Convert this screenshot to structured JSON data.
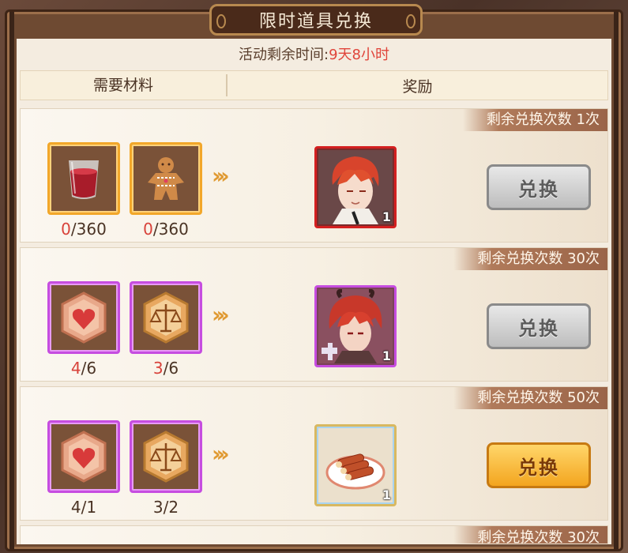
{
  "window": {
    "title": "限时道具兑换"
  },
  "timer": {
    "label": "活动剩余时间:",
    "value": "9天8小时"
  },
  "headers": {
    "materials": "需要材料",
    "reward": "奖励"
  },
  "rows": [
    {
      "remaining": "剩余兑换次数 1次",
      "materials": [
        {
          "icon": "juice-glass-icon",
          "have": "0",
          "need": "/360",
          "frame": "orange"
        },
        {
          "icon": "gingerbread-cookie-icon",
          "have": "0",
          "need": "/360",
          "frame": "orange"
        }
      ],
      "reward": {
        "icon": "red-hair-character-portrait",
        "qty": "1",
        "frame": "red"
      },
      "button": {
        "label": "兑换",
        "state": "disabled"
      }
    },
    {
      "remaining": "剩余兑换次数 30次",
      "materials": [
        {
          "icon": "heart-emblem-icon",
          "have": "4",
          "need": "/6",
          "frame": "purple"
        },
        {
          "icon": "scales-emblem-icon",
          "have": "3",
          "need": "/6",
          "frame": "purple"
        }
      ],
      "reward": {
        "icon": "character-fragment-portrait",
        "qty": "1",
        "frame": "purple"
      },
      "button": {
        "label": "兑换",
        "state": "disabled"
      }
    },
    {
      "remaining": "剩余兑换次数 50次",
      "materials": [
        {
          "icon": "heart-emblem-icon",
          "have": "4",
          "need": "/1",
          "frame": "purple"
        },
        {
          "icon": "scales-emblem-icon",
          "have": "3",
          "need": "/2",
          "frame": "purple"
        }
      ],
      "reward": {
        "icon": "sausage-rolls-plate-icon",
        "qty": "1",
        "frame": "rainbow"
      },
      "button": {
        "label": "兑换",
        "state": "active"
      }
    }
  ],
  "next_row_peek": {
    "remaining": "剩余兑换次数 30次"
  },
  "arrows": "›››",
  "colors": {
    "accent_red": "#e0443a",
    "button_gold": "#f3a51f",
    "button_grey": "#bdbdbd",
    "frame_purple": "#c64de0",
    "frame_orange": "#f2a72a"
  }
}
